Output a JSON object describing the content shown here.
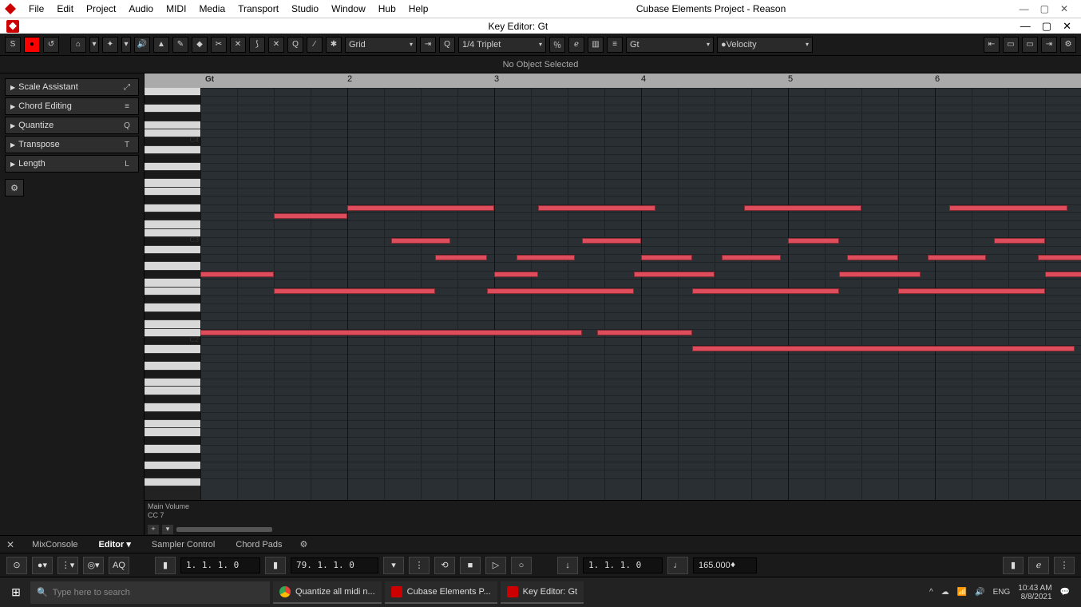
{
  "os_menubar": {
    "items": [
      "File",
      "Edit",
      "Project",
      "Audio",
      "MIDI",
      "Media",
      "Transport",
      "Studio",
      "Window",
      "Hub",
      "Help"
    ],
    "window_title": "Cubase Elements Project - Reason"
  },
  "key_editor": {
    "title": "Key Editor: Gt",
    "infoline": "No Object Selected",
    "snap_label": "Grid",
    "quantize_label": "1/4  Triplet",
    "track_select": "Gt",
    "controller_select": "Velocity",
    "ruler_track": "Gt",
    "ruler_bars": [
      "2",
      "3",
      "4",
      "5",
      "6"
    ],
    "piano_labels": [
      {
        "note": "C4",
        "row": 6
      },
      {
        "note": "C3",
        "row": 18
      },
      {
        "note": "C2",
        "row": 30
      }
    ],
    "cc_lane": "Main Volume\nCC 7"
  },
  "inspector": {
    "sections": [
      {
        "label": "Scale Assistant",
        "shortcut": "⤢"
      },
      {
        "label": "Chord Editing",
        "shortcut": "≡"
      },
      {
        "label": "Quantize",
        "shortcut": "Q"
      },
      {
        "label": "Transpose",
        "shortcut": "T"
      },
      {
        "label": "Length",
        "shortcut": "L"
      }
    ]
  },
  "chart_data": {
    "type": "table",
    "description": "MIDI notes in piano roll (approximate)",
    "rows_from_top": "row 0 ≈ top visible key; row 30 ≈ C2; row 18 ≈ C3; row 6 ≈ C4",
    "x_unit": "bars",
    "notes": [
      {
        "row": 15,
        "start": 1.5,
        "end": 2.0
      },
      {
        "row": 14,
        "start": 2.0,
        "end": 3.0
      },
      {
        "row": 18,
        "start": 2.3,
        "end": 2.7
      },
      {
        "row": 14,
        "start": 3.3,
        "end": 4.1
      },
      {
        "row": 18,
        "start": 3.6,
        "end": 4.0
      },
      {
        "row": 14,
        "start": 4.7,
        "end": 5.5
      },
      {
        "row": 18,
        "start": 5.0,
        "end": 5.35
      },
      {
        "row": 14,
        "start": 6.1,
        "end": 6.9
      },
      {
        "row": 18,
        "start": 6.4,
        "end": 6.75
      },
      {
        "row": 20,
        "start": 6.7,
        "end": 7.0
      },
      {
        "row": 20,
        "start": 4.0,
        "end": 4.35
      },
      {
        "row": 20,
        "start": 4.55,
        "end": 4.95
      },
      {
        "row": 20,
        "start": 5.4,
        "end": 5.75
      },
      {
        "row": 20,
        "start": 5.95,
        "end": 6.35
      },
      {
        "row": 20,
        "start": 2.6,
        "end": 2.95
      },
      {
        "row": 20,
        "start": 3.15,
        "end": 3.55
      },
      {
        "row": 22,
        "start": 1.0,
        "end": 1.5
      },
      {
        "row": 22,
        "start": 3.0,
        "end": 3.3
      },
      {
        "row": 22,
        "start": 3.95,
        "end": 4.5
      },
      {
        "row": 22,
        "start": 5.35,
        "end": 5.9
      },
      {
        "row": 22,
        "start": 6.75,
        "end": 7.0
      },
      {
        "row": 24,
        "start": 1.5,
        "end": 2.6
      },
      {
        "row": 24,
        "start": 2.95,
        "end": 3.95
      },
      {
        "row": 24,
        "start": 4.35,
        "end": 5.35
      },
      {
        "row": 24,
        "start": 5.75,
        "end": 6.75
      },
      {
        "row": 29,
        "start": 1.0,
        "end": 3.6
      },
      {
        "row": 29,
        "start": 3.7,
        "end": 4.35
      },
      {
        "row": 31,
        "start": 4.35,
        "end": 6.95
      }
    ]
  },
  "lower_tabs": {
    "items": [
      "MixConsole",
      "Editor",
      "Sampler Control",
      "Chord Pads"
    ],
    "active": "Editor"
  },
  "transport": {
    "aq": "AQ",
    "locator_left": "1. 1. 1.  0",
    "position": "79. 1. 1.  0",
    "locator_right": "1. 1. 1.  0",
    "tempo": "165.000"
  },
  "taskbar": {
    "search_placeholder": "Type here to search",
    "items": [
      {
        "label": "Quantize all midi n...",
        "icon": "chrome"
      },
      {
        "label": "Cubase Elements P...",
        "icon": "cubase"
      },
      {
        "label": "Key Editor: Gt",
        "icon": "cubase"
      }
    ],
    "lang": "ENG",
    "time": "10:43 AM",
    "date": "8/8/2021"
  }
}
